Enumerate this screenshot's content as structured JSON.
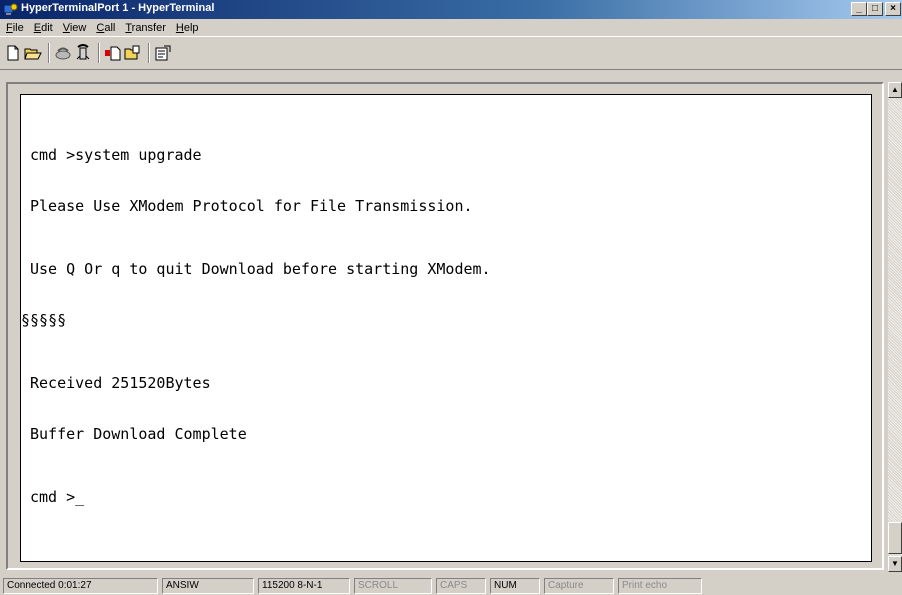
{
  "window": {
    "title": "HyperTerminalPort 1 - HyperTerminal",
    "controls": [
      "_",
      "□",
      "×"
    ]
  },
  "menu": [
    {
      "label": "File",
      "mnemonic": "F",
      "rest": "ile"
    },
    {
      "label": "Edit",
      "mnemonic": "E",
      "rest": "dit"
    },
    {
      "label": "View",
      "mnemonic": "V",
      "rest": "iew"
    },
    {
      "label": "Call",
      "mnemonic": "C",
      "rest": "all"
    },
    {
      "label": "Transfer",
      "mnemonic": "T",
      "rest": "ransfer"
    },
    {
      "label": "Help",
      "mnemonic": "H",
      "rest": "elp"
    }
  ],
  "toolbar": {
    "icons": [
      "new-file-icon",
      "open-folder-icon",
      "disconnect-phone-icon",
      "dial-phone-icon",
      "send-file-icon",
      "receive-file-icon",
      "properties-icon"
    ]
  },
  "terminal": {
    "lines": [
      "cmd >system upgrade",
      "Please Use XModem Protocol for File Transmission.",
      "Use Q Or q to quit Download before starting XModem.",
      "§§§§§",
      "Received 251520Bytes",
      "Buffer Download Complete",
      "cmd >_"
    ]
  },
  "status": {
    "connected": "Connected 0:01:27",
    "emulation": "ANSIW",
    "port_settings": "115200 8-N-1",
    "scroll": "SCROLL",
    "caps": "CAPS",
    "num": "NUM",
    "capture": "Capture",
    "print_echo": "Print echo"
  },
  "colors": {
    "titlebar_start": "#0a246a",
    "titlebar_end": "#a6caf0",
    "chrome": "#d4d0c8",
    "terminal_bg": "#ffffff"
  }
}
